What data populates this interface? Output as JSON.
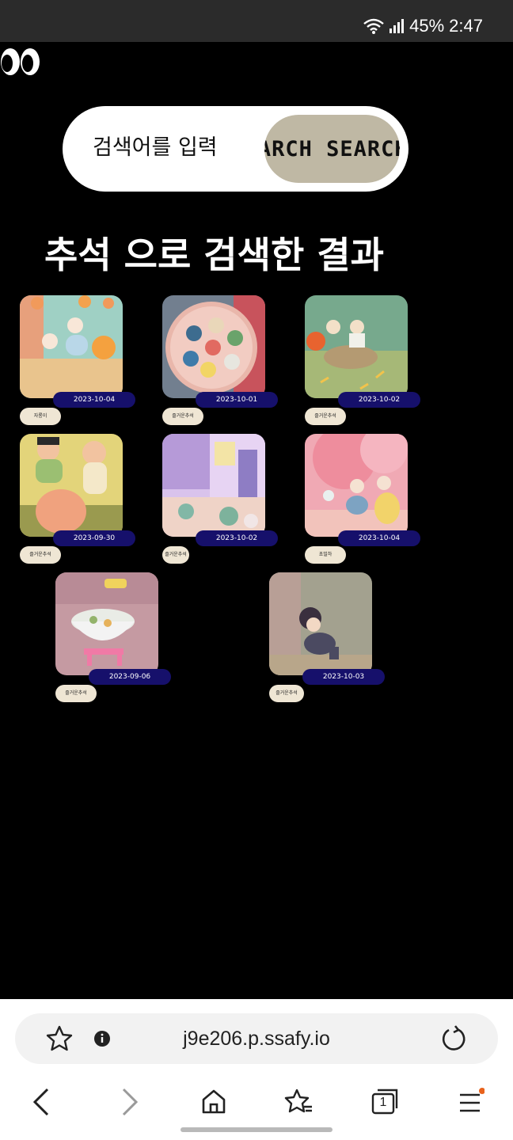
{
  "status_bar": {
    "battery": "45%",
    "time": "2:47"
  },
  "search": {
    "placeholder": "검색어를 입력",
    "button_label": "SEARCH SEARCH"
  },
  "result_title": "추석 으로 검색한 결과",
  "results": [
    {
      "date": "2023-10-04",
      "tag": "자롱이"
    },
    {
      "date": "2023-10-01",
      "tag": "즐거운추석"
    },
    {
      "date": "2023-10-02",
      "tag": "즐거운추석"
    },
    {
      "date": "2023-09-30",
      "tag": "즐거운추석"
    },
    {
      "date": "2023-10-02",
      "tag": "즐거운추석"
    },
    {
      "date": "2023-10-04",
      "tag": "초빌하"
    },
    {
      "date": "2023-09-06",
      "tag": "즐거운추석"
    },
    {
      "date": "2023-10-03",
      "tag": "즐거운추석"
    }
  ],
  "browser": {
    "url": "j9e206.p.ssafy.io",
    "tab_count": "1"
  },
  "colors": {
    "background": "#000000",
    "date_badge": "#16106b",
    "tag_bg": "#efe6d4",
    "search_button": "#bfb8a4"
  }
}
